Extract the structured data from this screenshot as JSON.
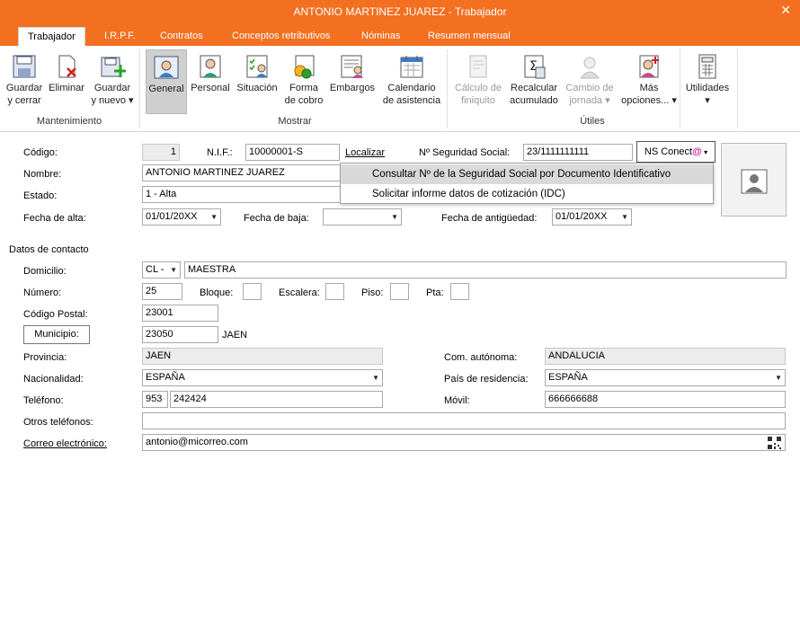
{
  "window": {
    "title": "ANTONIO MARTINEZ JUAREZ - Trabajador"
  },
  "tabs": [
    "Trabajador",
    "I.R.P.F.",
    "Contratos",
    "Conceptos retributivos",
    "Nóminas",
    "Resumen mensual"
  ],
  "ribbon": {
    "buttons": [
      {
        "l1": "Guardar",
        "l2": "y cerrar"
      },
      {
        "l1": "Eliminar",
        "l2": ""
      },
      {
        "l1": "Guardar",
        "l2": "y nuevo ▾"
      },
      {
        "l1": "General",
        "l2": ""
      },
      {
        "l1": "Personal",
        "l2": ""
      },
      {
        "l1": "Situación",
        "l2": ""
      },
      {
        "l1": "Forma",
        "l2": "de cobro"
      },
      {
        "l1": "Embargos",
        "l2": ""
      },
      {
        "l1": "Calendario",
        "l2": "de asistencia"
      },
      {
        "l1": "Cálculo de",
        "l2": "finiquito"
      },
      {
        "l1": "Recalcular",
        "l2": "acumulado"
      },
      {
        "l1": "Cambio de",
        "l2": "jornada ▾"
      },
      {
        "l1": "Más",
        "l2": "opciones... ▾"
      },
      {
        "l1": "Utilidades",
        "l2": "▾"
      }
    ],
    "groups": [
      "Mantenimiento",
      "Mostrar",
      "Útiles"
    ]
  },
  "form": {
    "codigo_label": "Código:",
    "codigo": "1",
    "nif_label": "N.I.F.:",
    "nif": "10000001-S",
    "localizar": "Localizar",
    "nss_label": "Nº Seguridad Social:",
    "nss": "23/1111111111",
    "ns_conecta": "NS Conect",
    "nombre_label": "Nombre:",
    "nombre": "ANTONIO MARTINEZ JUAREZ",
    "estado_label": "Estado:",
    "estado": "1 - Alta",
    "fecha_alta_label": "Fecha de alta:",
    "fecha_alta": "01/01/20XX",
    "fecha_baja_label": "Fecha de baja:",
    "fecha_baja": "",
    "fecha_antig_label": "Fecha de antigüedad:",
    "fecha_antig": "01/01/20XX",
    "contacto_label": "Datos de contacto",
    "domicilio_label": "Domicilio:",
    "via": "CL -",
    "domicilio": "MAESTRA",
    "numero_label": "Número:",
    "numero": "25",
    "bloque_label": "Bloque:",
    "escalera_label": "Escalera:",
    "piso_label": "Piso:",
    "pta_label": "Pta:",
    "cp_label": "Código Postal:",
    "cp": "23001",
    "municipio_btn": "Municipio:",
    "municipio_code": "23050",
    "municipio": "JAEN",
    "provincia_label": "Provincia:",
    "provincia": "JAEN",
    "comaut_label": "Com. autónoma:",
    "comaut": "ANDALUCIA",
    "nacionalidad_label": "Nacionalidad:",
    "nacionalidad": "ESPAÑA",
    "pais_label": "País de residencia:",
    "pais": "ESPAÑA",
    "telefono_label": "Teléfono:",
    "tel_prefix": "953",
    "telefono": "242424",
    "movil_label": "Móvil:",
    "movil": "666666688",
    "otros_label": "Otros teléfonos:",
    "otros": "",
    "email_label": "Correo electrónico:",
    "email": "antonio@micorreo.com"
  },
  "menu": {
    "item1": "Consultar Nº de la Seguridad Social por Documento Identificativo",
    "item2": "Solicitar informe datos de cotización (IDC)"
  },
  "colors": {
    "accent": "#f37021"
  }
}
